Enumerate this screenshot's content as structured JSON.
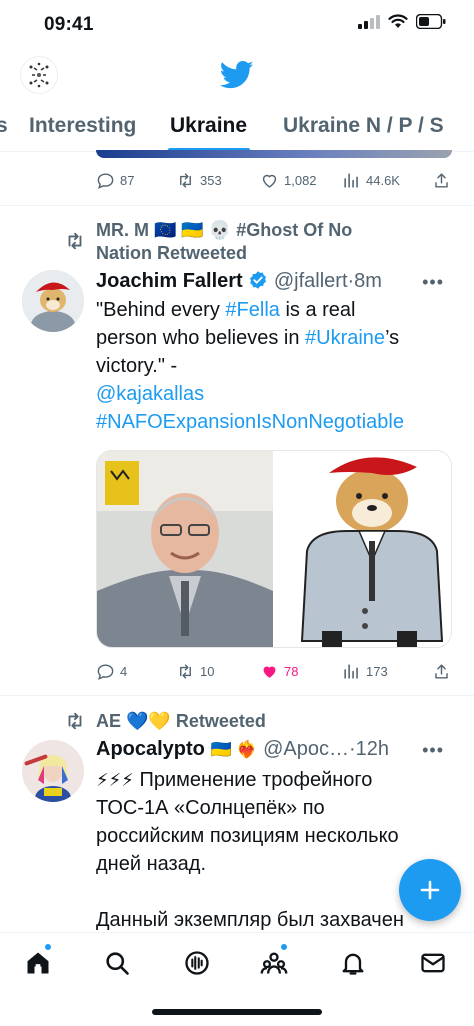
{
  "status_bar": {
    "time": "09:41"
  },
  "tabs": [
    {
      "label": "s"
    },
    {
      "label": "Interesting"
    },
    {
      "label": "Ukraine"
    },
    {
      "label": "Ukraine N / P / S"
    }
  ],
  "prev_tweet": {
    "replies": "87",
    "retweets": "353",
    "likes": "1,082",
    "views": "44.6K"
  },
  "tweet1": {
    "retweeted_by_line1": "MR. M 🇪🇺 🇺🇦 💀 #Ghost Of No",
    "retweeted_by_line2": "Nation Retweeted",
    "name": "Joachim Fallert",
    "handle": "@jfallert",
    "time": "·8m",
    "text_l1_a": "\"Behind every ",
    "text_l1_tag": "#Fella",
    "text_l1_b": " is a real",
    "text_l2_a": "person who believes in ",
    "text_l2_tag": "#Ukraine",
    "text_l2_b": "’s",
    "text_l3": "victory.\" -",
    "text_l4": "@kajakallas",
    "text_l5": "#NAFOExpansionIsNonNegotiable",
    "replies": "4",
    "retweets": "10",
    "likes": "78",
    "views": "173"
  },
  "tweet2": {
    "retweeted_by": "AE 💙💛 Retweeted",
    "name": "Apocalypto",
    "name_emoji": "🇺🇦 ❤️‍🔥",
    "handle": "@Apoc…",
    "time": "·12h",
    "text_l1_emoji": "⚡⚡⚡",
    "text_l1": " Применение трофейного",
    "text_l2": "ТОС-1А «Солнцепёк» по",
    "text_l3": "российским позициям несколько",
    "text_l4": "дней назад.",
    "text_l6": "Данный экземпляр был захвачен"
  },
  "icons": {
    "home": "home-icon",
    "search": "search-icon",
    "spaces": "spaces-icon",
    "communities": "communities-icon",
    "notifications": "bell-icon",
    "messages": "mail-icon",
    "compose": "plus-icon"
  },
  "colors": {
    "accent": "#1d9bf0",
    "like": "#f91880",
    "muted": "#536471"
  }
}
